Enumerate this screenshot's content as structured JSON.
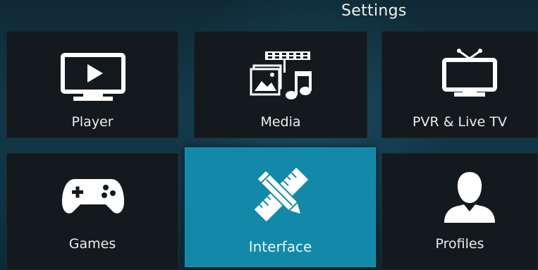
{
  "header": {
    "title": "Settings"
  },
  "tiles": [
    {
      "label": "Player",
      "icon": "tv-play-icon"
    },
    {
      "label": "Media",
      "icon": "media-icon"
    },
    {
      "label": "PVR & Live TV",
      "icon": "tv-antenna-icon"
    },
    {
      "label": "Games",
      "icon": "gamepad-icon"
    },
    {
      "label": "Interface",
      "icon": "pencil-ruler-icon"
    },
    {
      "label": "Profiles",
      "icon": "user-profile-icon"
    }
  ],
  "colors": {
    "focus_tile": "#1389aa",
    "tile": "#13191d",
    "background": "#133746"
  },
  "focused_tile": "Interface"
}
